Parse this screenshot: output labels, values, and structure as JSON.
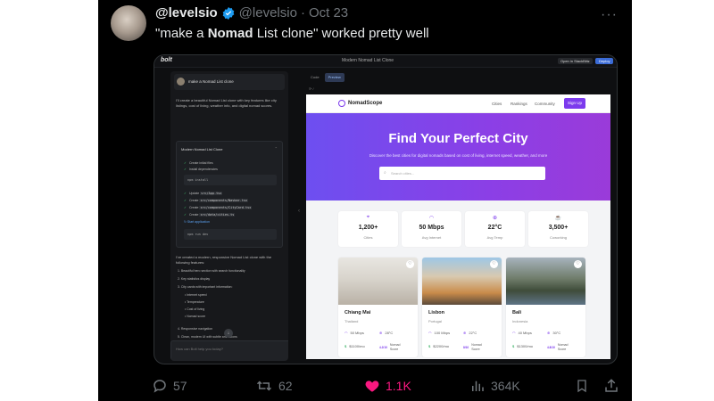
{
  "tweet": {
    "display_name": "@levelsio",
    "handle": "@levelsio",
    "separator": "·",
    "date": "Oct 23",
    "more": "···",
    "text_before": "\"make a ",
    "text_bold": "Nomad",
    "text_after": " List clone\" worked pretty well"
  },
  "app": {
    "brand": "bolt",
    "window_title": "Modern Nomad List Clone",
    "open_button": "Open in StackBlitz",
    "deploy_button": "Deploy"
  },
  "chat": {
    "user_message": "make a Nomad List clone",
    "intro": "I'll create a beautiful Nomad List clone with key features like city listings, cost of living, weather info, and digital nomad scores.",
    "artifact_title": "Modern Nomad List Clone",
    "steps": [
      {
        "label": "Create initial files"
      },
      {
        "label": "Install dependencies"
      },
      {
        "label": "Update",
        "code": "src/App.tsx"
      },
      {
        "label": "Create",
        "code": "src/components/Navbar.tsx"
      },
      {
        "label": "Create",
        "code": "src/components/CityCard.tsx"
      },
      {
        "label": "Create",
        "code": "src/data/cities.ts"
      },
      {
        "label": "Start application"
      }
    ],
    "cmd_install": "npm install",
    "cmd_dev": "npm run dev",
    "summary": "I've created a modern, responsive Nomad List clone with the following features:",
    "features": [
      "1. Beautiful hero section with search functionality",
      "2. Key statistics display",
      "3. City cards with important information:",
      "• Internet speed",
      "• Temperature",
      "• Cost of living",
      "• Nomad score",
      "4. Responsive navigation",
      "5. Clean, modern UI with subtle animations"
    ],
    "scroll_down": "↓",
    "input_placeholder": "How can Bolt help you today?",
    "input_tools": "⊘ ✎"
  },
  "preview": {
    "tabs": [
      "Code",
      "Preview"
    ],
    "active_tab": "Preview",
    "url": "⟳ /"
  },
  "site": {
    "name": "NomadScope",
    "nav": [
      "Cities",
      "Rankings",
      "Community"
    ],
    "signup": "Sign Up",
    "hero_title": "Find Your Perfect City",
    "hero_sub": "Discover the best cities for digital nomads based on cost of living, internet speed, weather, and more",
    "search_placeholder": "Search cities...",
    "stats": [
      {
        "icon": "location-pin-icon",
        "glyph": "⌖",
        "value": "1,200+",
        "label": "Cities"
      },
      {
        "icon": "wifi-icon",
        "glyph": "◠",
        "value": "50 Mbps",
        "label": "Avg Internet"
      },
      {
        "icon": "thermometer-icon",
        "glyph": "⊕",
        "value": "22°C",
        "label": "Avg Temp"
      },
      {
        "icon": "coffee-icon",
        "glyph": "☕",
        "value": "3,500+",
        "label": "Coworking"
      }
    ],
    "cities": [
      {
        "name": "Chiang Mai",
        "country": "Thailand",
        "internet": "50 Mbps",
        "temp": "28°C",
        "cost": "$1100/mo",
        "score": "4.2/10",
        "score_label": [
          "Nomad",
          "Score"
        ]
      },
      {
        "name": "Lisbon",
        "country": "Portugal",
        "internet": "100 Mbps",
        "temp": "22°C",
        "cost": "$2200/mo",
        "score": "8/10",
        "score_label": [
          "Nomad",
          "Score"
        ]
      },
      {
        "name": "Bali",
        "country": "Indonesia",
        "internet": "40 Mbps",
        "temp": "30°C",
        "cost": "$1300/mo",
        "score": "4.8/10",
        "score_label": [
          "Nomad",
          "Score"
        ]
      }
    ]
  },
  "actions": {
    "replies": "57",
    "reposts": "62",
    "likes": "1.1K",
    "views": "364K"
  },
  "colors": {
    "accent": "#7c3aed",
    "like": "#f91880",
    "verified": "#1d9bf0"
  }
}
